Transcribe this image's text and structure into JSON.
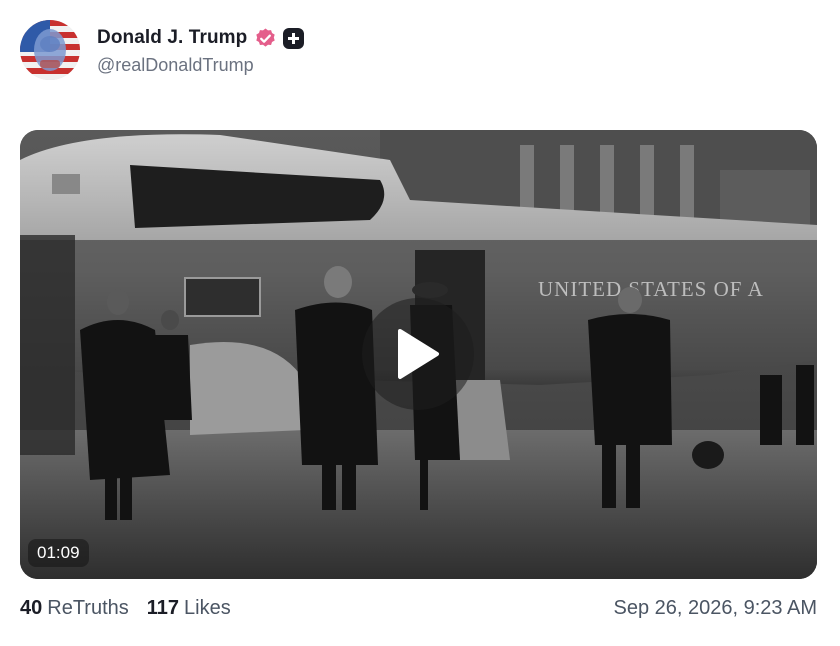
{
  "post": {
    "author_name": "Donald J. Trump",
    "handle": "@realDonaldTrump",
    "verified_icon": "verified-badge-icon",
    "plus_icon": "plus-badge-icon",
    "accent_color": "#e45e8b",
    "video": {
      "duration": "01:09",
      "play_icon": "play-icon",
      "helicopter_text": "UNITED STATES OF A"
    },
    "stats": {
      "retruths_count": "40",
      "retruths_label": "ReTruths",
      "likes_count": "117",
      "likes_label": "Likes"
    },
    "timestamp": "Sep 26, 2026, 9:23 AM"
  }
}
